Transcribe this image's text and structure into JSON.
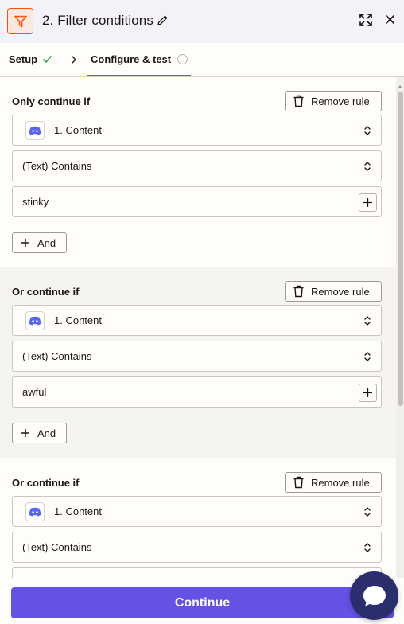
{
  "header": {
    "title": "2. Filter conditions",
    "app_icon": "filter-icon",
    "edit_icon": "pencil-icon",
    "expand_icon": "expand-icon",
    "close_icon": "close-icon"
  },
  "tabs": {
    "setup_label": "Setup",
    "setup_status": "complete",
    "configure_label": "Configure & test",
    "configure_status": "incomplete"
  },
  "rules": [
    {
      "label": "Only continue if",
      "remove_label": "Remove rule",
      "field": "1. Content",
      "condition": "(Text) Contains",
      "value": "stinky",
      "and_label": "And"
    },
    {
      "label": "Or continue if",
      "remove_label": "Remove rule",
      "field": "1. Content",
      "condition": "(Text) Contains",
      "value": "awful",
      "and_label": "And"
    },
    {
      "label": "Or continue if",
      "remove_label": "Remove rule",
      "field": "1. Content",
      "condition": "(Text) Contains",
      "value": ""
    }
  ],
  "footer": {
    "continue_label": "Continue"
  },
  "colors": {
    "accent": "#6451e5",
    "brand_orange": "#ff4f00",
    "success_green": "#2f9e44",
    "discord": "#5865f2",
    "chat_bubble_bg": "#2b2e6d"
  }
}
